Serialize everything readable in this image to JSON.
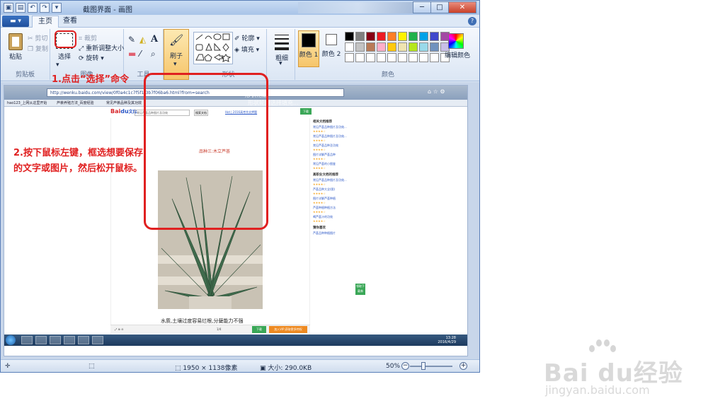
{
  "window": {
    "title": "截图界面 - 画图",
    "buttons": {
      "minimize": "─",
      "maximize": "□",
      "close": "✕"
    }
  },
  "tabs": {
    "file": "▬ ▾",
    "home": "主页",
    "view": "查看"
  },
  "ribbon": {
    "clipboard": {
      "paste": "粘贴",
      "cut": "剪切",
      "copy": "复制",
      "label": "剪贴板"
    },
    "image": {
      "select": "选择",
      "crop": "裁剪",
      "resize": "重新调整大小",
      "rotate": "旋转",
      "label": "图像"
    },
    "tools": {
      "label": "工具"
    },
    "brushes": {
      "label": "刷子"
    },
    "shapes": {
      "outline": "轮廓",
      "fill": "填充",
      "label": "形状"
    },
    "size": {
      "label": "粗细"
    },
    "colors": {
      "color1": "颜色 1",
      "color2": "颜色 2",
      "edit": "编辑颜色",
      "label": "颜色"
    }
  },
  "palette": [
    "#000000",
    "#7f7f7f",
    "#880015",
    "#ed1c24",
    "#ff7f27",
    "#fff200",
    "#22b14c",
    "#00a2e8",
    "#3f48cc",
    "#a349a4",
    "#ffffff",
    "#c3c3c3",
    "#b97a57",
    "#ffaec9",
    "#ffc90e",
    "#efe4b0",
    "#b5e61d",
    "#99d9ea",
    "#7092be",
    "#c8bfe7"
  ],
  "canvas": {
    "address": "http://wenku.baidu.com/view/0f0a4c1c7f5f1f3b7f06ba6.html?from=search",
    "browser_tabs": [
      "hao123_上网从这里开始",
      "芦荟养殖方法_百度经验",
      "常见芦荟品种及其功效"
    ],
    "overlay": {
      "outline": "形状轮廓",
      "fill": "形状轮廓选择填充..."
    },
    "baidu": {
      "logo_a": "Bai",
      "logo_b": "du",
      "logo_c": "文库",
      "search_placeholder": "常见芦荟品种图片及功效",
      "search_btn": "搜索文档",
      "link": "Hot | 2016高考作文押题",
      "download": "下载"
    },
    "doc_title": "品种三:木立芦荟",
    "caption": "水质,土壤过度容易烂根,分蘖能力不强",
    "sidebar": {
      "section1": "相关文档推荐",
      "items1": [
        "常见芦荟品种图片及功效...",
        "常见芦荟品种图片及功效...",
        "常见芦荟品种及功效",
        "图片详解芦荟品种",
        "常见芦荟的小图鉴"
      ],
      "section2": "高职业文档的推荐",
      "items2": [
        "常见芦荟品种图片及功效...",
        "芦荟品种大全(图)",
        "图片详解芦荟种植",
        "芦荟种植种植方法",
        "喝芦荟汁的功效"
      ],
      "section3": "猜你喜欢",
      "items3": [
        "芦荟品种种植图片"
      ],
      "stars": "★★★★☆"
    },
    "float_btn": "领取下载券",
    "bottom": {
      "green": "下载",
      "orange": "加入VIP,获取更多特权",
      "page": "1/4"
    },
    "clock": {
      "time": "13:28",
      "date": "2016/4/29"
    }
  },
  "annotations": {
    "step1": "1.点击“选择”命令",
    "step2": "2.按下鼠标左键，框选想要保存的文字或图片，然后松开鼠标。"
  },
  "status": {
    "size": "1950 × 1138像素",
    "filesize": "大小: 290.0KB",
    "zoom": "50%"
  },
  "watermark": {
    "brand": "Bai du经验",
    "url": "jingyan.baidu.com"
  },
  "colors": {
    "accent_red": "#e02020",
    "ribbon_bg": "#dbe6f4"
  }
}
